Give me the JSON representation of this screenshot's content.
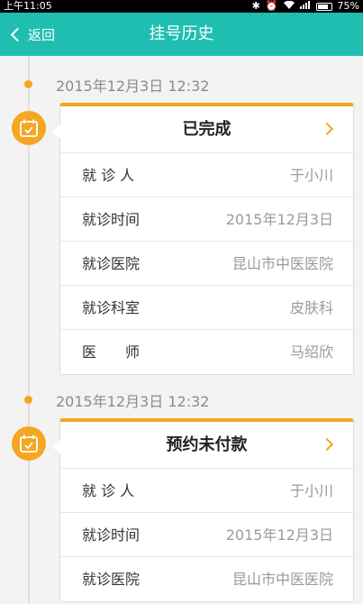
{
  "status_bar": {
    "time": "上午11:05",
    "battery": "75%",
    "battery_level": 0.75
  },
  "header": {
    "back_label": "返回",
    "title": "挂号历史"
  },
  "records": [
    {
      "datetime": "2015年12月3日 12:32",
      "status": "已完成",
      "fields": [
        {
          "label": "就 诊 人",
          "value": "于小川"
        },
        {
          "label": "就诊时间",
          "value": "2015年12月3日"
        },
        {
          "label": "就诊医院",
          "value": "昆山市中医医院"
        },
        {
          "label": "就诊科室",
          "value": "皮肤科"
        },
        {
          "label": "医　　师",
          "value": "马绍欣"
        }
      ]
    },
    {
      "datetime": "2015年12月3日 12:32",
      "status": "预约未付款",
      "fields": [
        {
          "label": "就 诊 人",
          "value": "于小川"
        },
        {
          "label": "就诊时间",
          "value": "2015年12月3日"
        },
        {
          "label": "就诊医院",
          "value": "昆山市中医医院"
        }
      ]
    }
  ],
  "colors": {
    "header_bg": "#1fbeb0",
    "accent": "#f5a623",
    "background": "#f3f3f3"
  }
}
